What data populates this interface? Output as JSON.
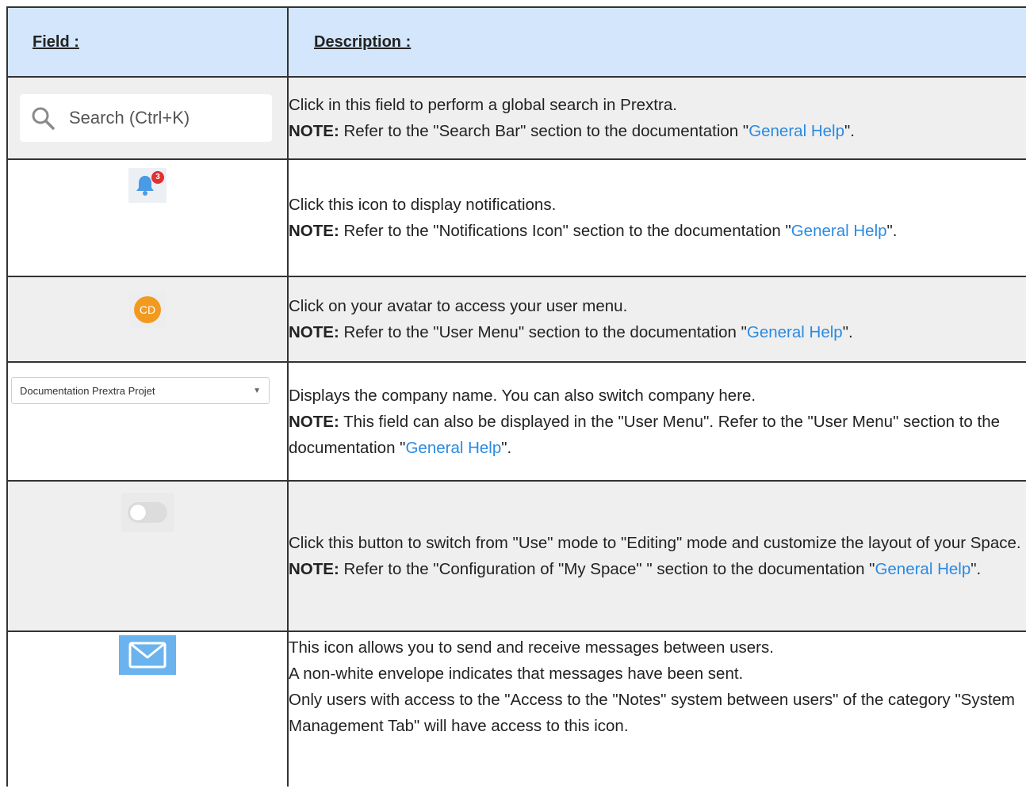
{
  "header": {
    "field_label": "Field :",
    "description_label": "Description :"
  },
  "colors": {
    "header_bg": "#d3e6fb",
    "row_grey": "#efefef",
    "link": "#2a8ae2",
    "badge": "#e32f2f",
    "avatar": "#f29a20",
    "envelope": "#6ab3ee"
  },
  "rows": [
    {
      "field": {
        "type": "search-input",
        "placeholder": "Search (Ctrl+K)",
        "icon": "search-icon"
      },
      "description": "Click in this field to perform a global search in Prextra.",
      "note_label": "NOTE:",
      "note_before": " Refer to the \"Search Bar\" section to the documentation \"",
      "note_link": "General Help",
      "note_after": "\"."
    },
    {
      "field": {
        "type": "icon",
        "icon": "bell-icon",
        "badge": "3"
      },
      "description": "Click this icon to display notifications.",
      "note_label": "NOTE:",
      "note_before": " Refer to the \"Notifications Icon\" section to the documentation \"",
      "note_link": "General Help",
      "note_after": "\"."
    },
    {
      "field": {
        "type": "avatar",
        "initials": "CD"
      },
      "description": "Click on your avatar to access your user menu.",
      "note_label": "NOTE:",
      "note_before": " Refer to the \"User Menu\" section to the documentation \"",
      "note_link": "General Help",
      "note_after": "\"."
    },
    {
      "field": {
        "type": "select",
        "value": "Documentation Prextra Projet",
        "icon": "caret-down-icon"
      },
      "description": "Displays the company name. You can also switch company here.",
      "note_label": "NOTE:",
      "note_before": " This field can also be displayed in the \"User Menu\". Refer to the \"User Menu\" section to the documentation \"",
      "note_link": "General Help",
      "note_after": "\"."
    },
    {
      "field": {
        "type": "toggle",
        "state": "off"
      },
      "description": "Click this button to switch from \"Use\" mode to \"Editing\" mode and customize the layout of your Space.",
      "note_label": "NOTE:",
      "note_before": " Refer to the \"Configuration of \"My Space\" \" section to the documentation \"",
      "note_link": "General Help",
      "note_after": "\"."
    },
    {
      "field": {
        "type": "icon",
        "icon": "envelope-icon"
      },
      "lines": [
        "This icon allows you to send and receive messages between users.",
        "A non-white envelope indicates that messages have been sent.",
        "Only users with access to the \"Access to the \"Notes\" system between users\" of the category \"System Management Tab\" will have access to this icon."
      ]
    }
  ]
}
